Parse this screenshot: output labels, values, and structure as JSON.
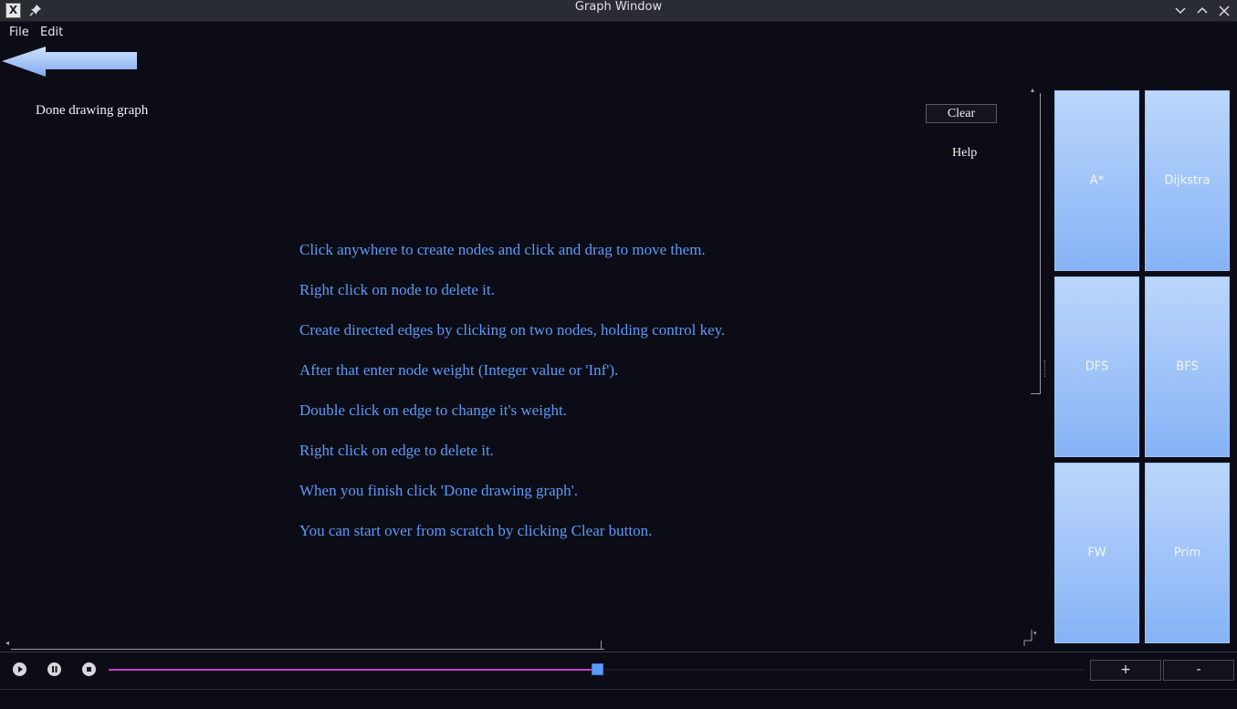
{
  "window": {
    "title": "Graph Window",
    "app_icon": "X",
    "controls": [
      "chevron-down-icon",
      "chevron-up-icon",
      "close-icon"
    ]
  },
  "menu": {
    "file": "File",
    "edit": "Edit"
  },
  "canvas": {
    "done_label": "Done drawing graph",
    "clear_label": "Clear",
    "help_label": "Help",
    "instructions": [
      "Click anywhere to create nodes and click and drag to move them.",
      "Right click on node to delete it.",
      "Create directed edges by clicking on two nodes, holding control key.",
      "After that enter node weight (Integer value or 'Inf').",
      "Double click on edge to change it's weight.",
      "Right click on edge to delete it.",
      "When you finish click 'Done drawing graph'.",
      "You can start over from scratch by clicking Clear button."
    ]
  },
  "algorithms": [
    "A*",
    "Dijkstra",
    "DFS",
    "BFS",
    "FW",
    "Prim"
  ],
  "playback": {
    "progress": 0.5,
    "zoom_in": "+",
    "zoom_out": "-"
  },
  "colors": {
    "background": "#0c0c16",
    "instruction_text": "#5b9bf7",
    "slider_fill": "#c83ccf",
    "slider_handle": "#5b9bf7",
    "algo_button_top": "#bcd6fb",
    "algo_button_bottom": "#86b3f6"
  }
}
